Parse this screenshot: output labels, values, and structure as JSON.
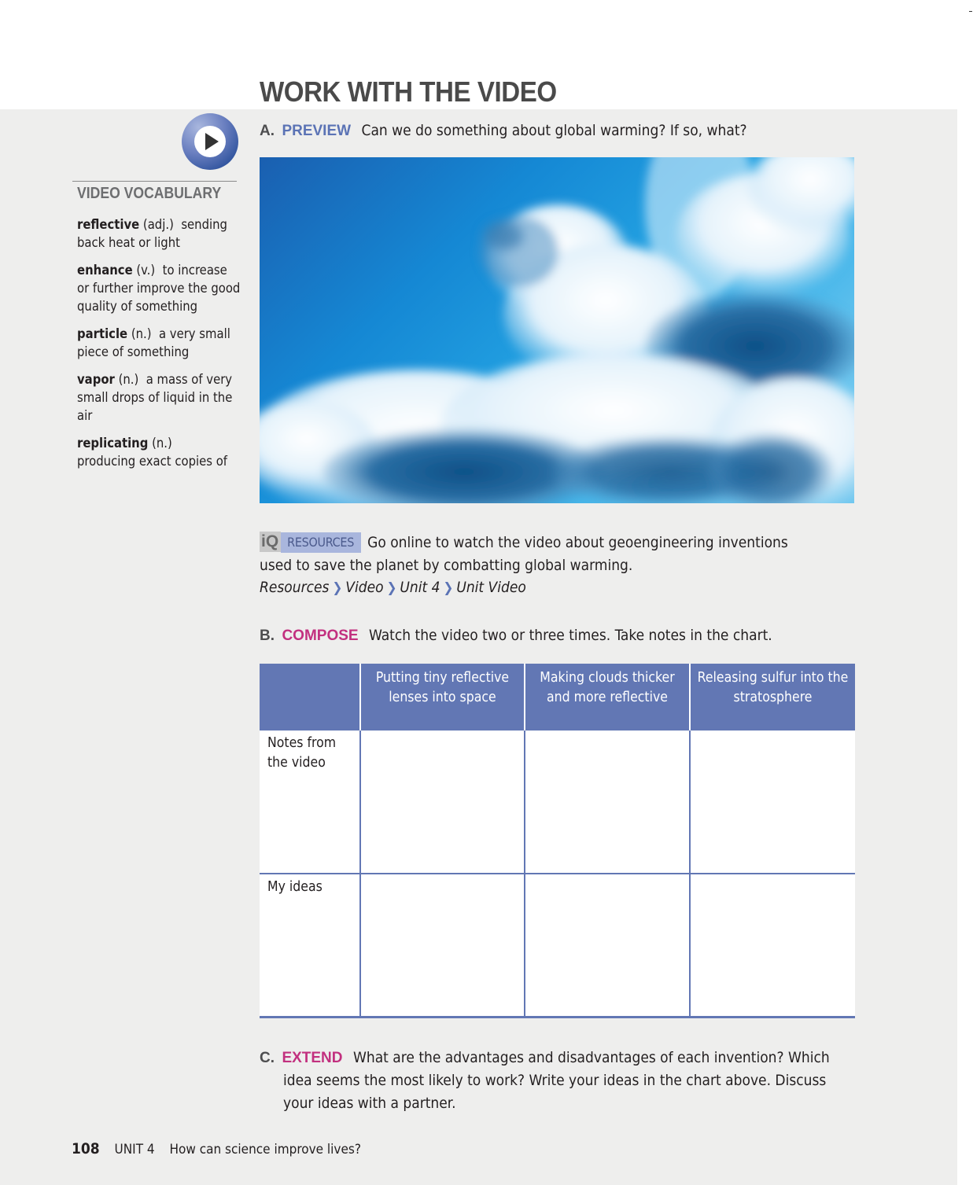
{
  "page": {
    "title": "WORK WITH THE VIDEO"
  },
  "sidebar": {
    "icon": "play-video-icon",
    "vocab_heading": "VIDEO VOCABULARY",
    "vocab": [
      {
        "term": "reflective",
        "pos": "(adj.)",
        "definition": "sending back heat or light"
      },
      {
        "term": "enhance",
        "pos": "(v.)",
        "definition": "to increase or further improve the good quality of something"
      },
      {
        "term": "particle",
        "pos": "(n.)",
        "definition": "a very small piece of something"
      },
      {
        "term": "vapor",
        "pos": "(n.)",
        "definition": "a mass of very small drops of liquid in the air"
      },
      {
        "term": "replicating",
        "pos": "(n.)",
        "definition": "producing exact copies of"
      }
    ]
  },
  "sections": {
    "a": {
      "letter": "A.",
      "label": "PREVIEW",
      "text": "Can we do something about global warming? If so, what?"
    },
    "resources": {
      "badge_iq": "iQ",
      "badge_label": "RESOURCES",
      "text": "Go online to watch the video about geoengineering inventions used to save the planet by combatting global warming.",
      "path": [
        "Resources",
        "Video",
        "Unit 4",
        "Unit Video"
      ],
      "separator_icon": "chevron-right-icon"
    },
    "b": {
      "letter": "B.",
      "label": "COMPOSE",
      "text": "Watch the video two or three times. Take notes in the chart."
    },
    "c": {
      "letter": "C.",
      "label": "EXTEND",
      "text": "What are the advantages and disadvantages of each invention? Which idea seems the most likely to work? Write your ideas in the chart above. Discuss your ideas with a partner."
    }
  },
  "photo": {
    "description": "blue sky with cumulus clouds"
  },
  "chart_table": {
    "columns": [
      "",
      "Putting tiny reflective lenses into space",
      "Making clouds thicker and more reflective",
      "Releasing sulfur into the stratosphere"
    ],
    "rows": [
      {
        "label": "Notes from the video",
        "cells": [
          "",
          "",
          ""
        ]
      },
      {
        "label": "My ideas",
        "cells": [
          "",
          "",
          ""
        ]
      }
    ]
  },
  "colors": {
    "accent_blue": "#5b73b5",
    "accent_magenta": "#c2307f",
    "table_header": "#6277b4",
    "panel_bg": "#eeeeed"
  },
  "footer": {
    "page_number": "108",
    "unit": "UNIT 4",
    "unit_question": "How can science improve lives?"
  }
}
